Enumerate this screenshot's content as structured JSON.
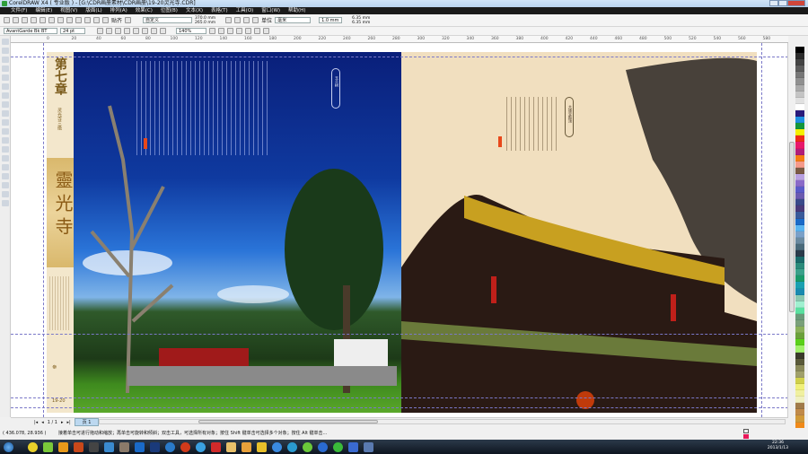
{
  "window": {
    "title": "CorelDRAW X4 ( 专业版 ) - [G:\\CDR画册素材\\CDR画册\\19-20灵光寺.CDR]"
  },
  "menu": [
    "文件(F)",
    "编辑(E)",
    "视图(V)",
    "版面(L)",
    "排列(A)",
    "效果(C)",
    "位图(B)",
    "文本(X)",
    "表格(T)",
    "工具(O)",
    "窗口(W)",
    "帮助(H)"
  ],
  "toolbar": {
    "snap_label": "贴齐",
    "page_preset": "自定义",
    "page_width": "370.0 mm",
    "page_height": "265.0 mm",
    "units_label": "单位",
    "units": "毫米",
    "nudge": "1.0 mm",
    "dup_x": "6.35 mm",
    "dup_y": "6.35 mm"
  },
  "textbar": {
    "font": "AvantGarde Bk BT",
    "size": "24 pt",
    "zoom": "140%"
  },
  "ruler": [
    "0",
    "20",
    "40",
    "60",
    "80",
    "100",
    "120",
    "140",
    "160",
    "180",
    "200",
    "220",
    "240",
    "260",
    "280",
    "300",
    "320",
    "340",
    "360",
    "380",
    "400",
    "420",
    "440",
    "460",
    "480",
    "500",
    "520",
    "540",
    "560",
    "580"
  ],
  "document": {
    "chapter": "第七章",
    "subtitle": "灵光寺三绝",
    "seal_title": "靈光寺",
    "page_numbers": "19-20",
    "left_label": "玉兰树",
    "right_label": "大雄宝殿顶"
  },
  "pagebar": {
    "page_count": "1 / 1",
    "tab": "页 1"
  },
  "status": {
    "coords": "( 436.078, 28.936 )",
    "hint": "接着单击可进行拖动和缩放；再单击可旋转和倾斜；双击工具，可选择所有对象；按住 Shift 键单击可选择多个对象；按住 Alt 键单击..."
  },
  "clock": {
    "time": "22:36",
    "date": "2013/1/13"
  },
  "palette": [
    "#000000",
    "#2b2b2b",
    "#444444",
    "#5c5c5c",
    "#777777",
    "#909090",
    "#aaaaaa",
    "#c4c4c4",
    "#e0e0e0",
    "#ffffff",
    "#2a1a7a",
    "#1f8fe0",
    "#14963c",
    "#f5f000",
    "#ee2a1a",
    "#e8186a",
    "#b01e7a",
    "#f57c14",
    "#f59a8a",
    "#7a5a44",
    "#b8a0e0",
    "#8a6ac8",
    "#5a5ac8",
    "#6a5ab0",
    "#3a4a8a",
    "#4a3a7a",
    "#3a5a9a",
    "#1a6ac8",
    "#5ab4f0",
    "#7aa0c8",
    "#6a8aa0",
    "#4a6a7a",
    "#2a3a4a",
    "#1a6a6a",
    "#2a8a7a",
    "#3aa08a",
    "#1a9a6a",
    "#1aa0b0",
    "#1a8ab0",
    "#8ac8b0",
    "#a0f0d0",
    "#5ae0a0",
    "#6a9a7a",
    "#7aa07a",
    "#8ab05a",
    "#6aa03a",
    "#5ad01a",
    "#a0f06a",
    "#3a3a2a",
    "#5a5a3a",
    "#8a8a5a",
    "#a0a06a",
    "#d0d04a",
    "#f0f07a",
    "#f0f0a0",
    "#f0f0c0",
    "#a07a4a",
    "#c08a4a",
    "#d09a3a",
    "#f08a1a",
    "#f09a3a",
    "#f0b06a",
    "#f0c01a",
    "#f0d0a0"
  ],
  "colors": {
    "menubar": "#1a1a1a",
    "titlebar": "#c4dbf3",
    "sky": "#0b2a8a",
    "cream": "#f1dfbf",
    "gold_band": "#e6c98a"
  }
}
